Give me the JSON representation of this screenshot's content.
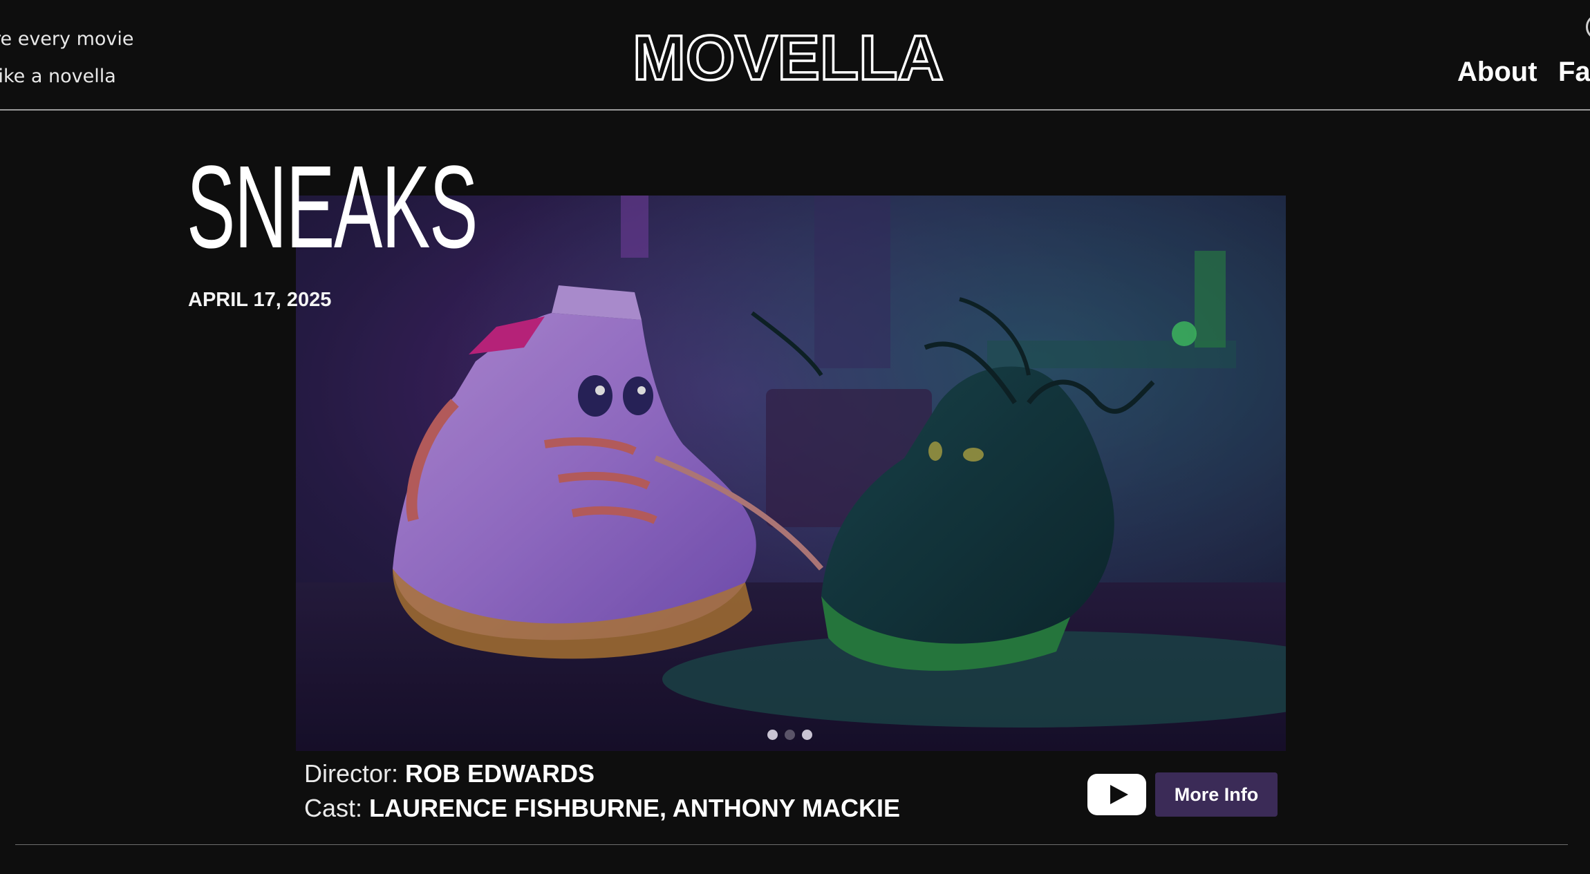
{
  "header": {
    "tagline_line1": "re every movie",
    "tagline_line2": "like a novella",
    "logo_text": "MOVELLA",
    "nav": {
      "about": "About",
      "favorites": "Fav"
    }
  },
  "featured": {
    "title": "SNEAKS",
    "date": "APRIL 17, 2025",
    "director_label": "Director:",
    "director": "ROB EDWARDS",
    "cast_label": "Cast:",
    "cast": "LAURENCE FISHBURNE, ANTHONY MACKIE",
    "carousel": {
      "slides": 3,
      "active": 2
    },
    "more_info_label": "More Info"
  },
  "colors": {
    "background": "#0e0e0e",
    "button": "#3b2b57",
    "accent_purple": "#8a53d8",
    "accent_green": "#33d07a"
  }
}
